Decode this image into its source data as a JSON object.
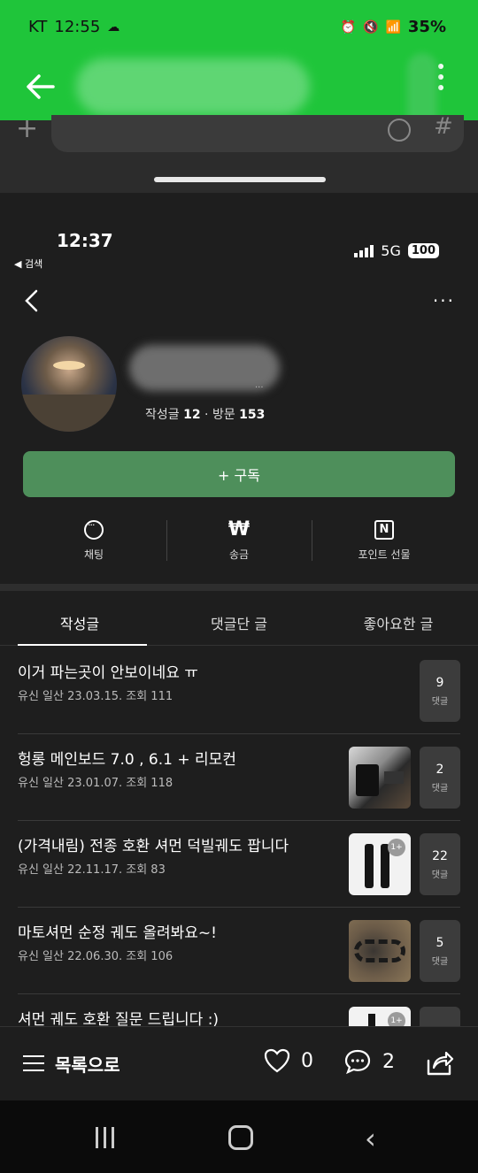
{
  "outer_status": {
    "carrier": "KT",
    "time": "12:55",
    "battery": "35%"
  },
  "outer_input": {
    "plus": "+",
    "hash": "#"
  },
  "inner_status": {
    "time": "12:37",
    "back_label": "◀ 검색",
    "network": "5G",
    "battery": "100"
  },
  "profile": {
    "name_suffix": "...",
    "stats_posts_label": "작성글",
    "stats_posts": "12",
    "stats_sep": "·",
    "stats_visits_label": "방문",
    "stats_visits": "153",
    "subscribe_label": "+ 구독"
  },
  "actions": [
    {
      "label": "채팅",
      "icon": "chat-icon"
    },
    {
      "label": "송금",
      "icon": "won-icon"
    },
    {
      "label": "포인트 선물",
      "icon": "naver-point-icon"
    }
  ],
  "tabs": [
    {
      "label": "작성글",
      "active": true
    },
    {
      "label": "댓글단 글",
      "active": false
    },
    {
      "label": "좋아요한 글",
      "active": false
    }
  ],
  "posts": [
    {
      "title": "이거 파는곳이 안보이네요 ㅠ",
      "meta": "유신 일산   23.03.15.   조회 111",
      "comments": "9",
      "comments_label": "댓글"
    },
    {
      "title": "헝롱 메인보드 7.0 , 6.1 + 리모컨",
      "meta": "유신 일산   23.01.07.   조회 118",
      "comments": "2",
      "comments_label": "댓글"
    },
    {
      "title": "(가격내림) 전종 호환 셔먼 덕빌궤도 팝니다",
      "meta": "유신 일산   22.11.17.   조회 83",
      "comments": "22",
      "comments_label": "댓글",
      "badge": "1+"
    },
    {
      "title": "마토셔먼 순정 궤도 올려봐요~!",
      "meta": "유신 일산   22.06.30.   조회 106",
      "comments": "5",
      "comments_label": "댓글"
    },
    {
      "title": "셔먼 궤도 호환 질문 드립니다 :)",
      "meta": "",
      "comments": "",
      "comments_label": "",
      "badge": "1+"
    }
  ],
  "bottom": {
    "list_label": "목록으로",
    "likes": "0",
    "comments": "2"
  }
}
